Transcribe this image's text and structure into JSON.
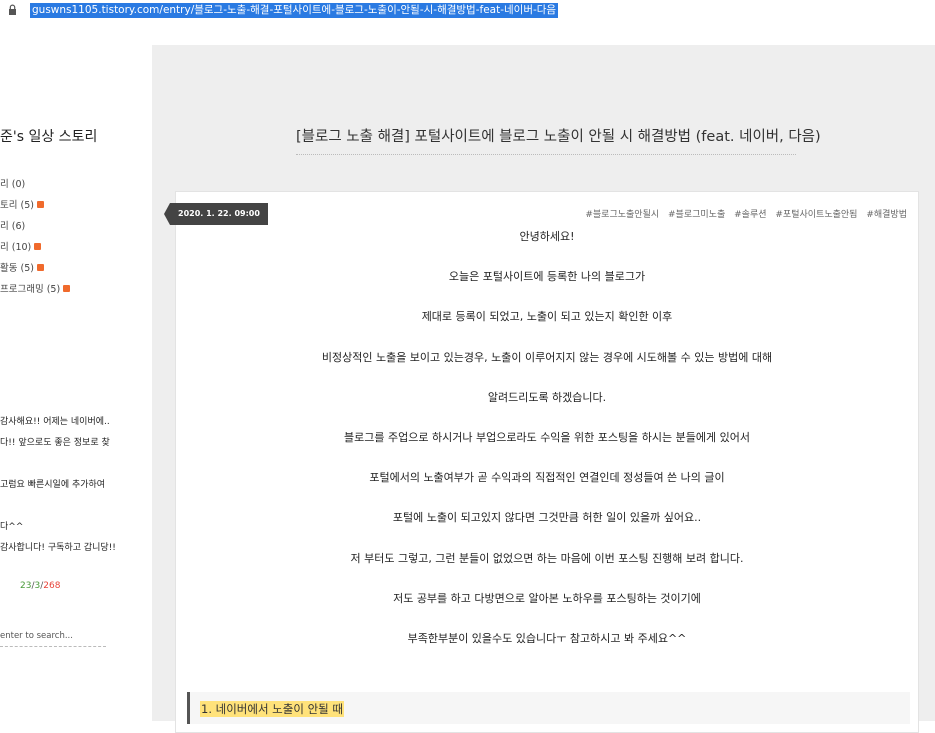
{
  "address_bar": {
    "url": "guswns1105.tistory.com/entry/블로그-노출-해결-포털사이트에-블로그-노출이-안될-시-해결방법-feat-네이버-다음",
    "url_highlight_color": "#2a7ae2"
  },
  "sidebar": {
    "blog_title": "준's 일상 스토리",
    "categories": [
      {
        "label": "리 (0)",
        "new": false
      },
      {
        "label": "토리 (5)",
        "new": true
      },
      {
        "label": "리 (6)",
        "new": false
      },
      {
        "label": "리 (10)",
        "new": true
      },
      {
        "label": "활동 (5)",
        "new": true
      },
      {
        "label": "프로그래밍 (5)",
        "new": true
      }
    ],
    "recent_comments": [
      "감사해요!! 어제는 네이버에..",
      "다!! 앞으로도 좋은 정보로 찾",
      "",
      "고럼요 빠른시일에 추가하여",
      "",
      "다^^",
      "감사합니다! 구독하고 갑니당!!"
    ],
    "counter": {
      "today": "23",
      "yesterday": "3",
      "total": "268",
      "separator": "/"
    },
    "search": {
      "placeholder": "enter to search..."
    }
  },
  "post": {
    "title": "[블로그 노출 해결] 포털사이트에 블로그 노출이 안될 시 해결방법 (feat. 네이버, 다음)",
    "date": "2020. 1. 22. 09:00",
    "tags": [
      "#블로그노출안될시",
      "#블로그미노출",
      "#솔루션",
      "#포털사이트노출안됨",
      "#해결방법"
    ],
    "paragraphs": [
      "안녕하세요!",
      "오늘은 포털사이트에 등록한 나의 블로그가",
      "제대로 등록이 되었고, 노출이 되고 있는지 확인한 이후",
      "비정상적인 노출을 보이고 있는경우, 노출이 이루어지지 않는 경우에 시도해볼 수 있는 방법에 대해",
      "알려드리도록 하겠습니다.",
      "블로그를 주업으로 하시거나 부업으로라도 수익을 위한 포스팅을 하시는 분들에게 있어서",
      "포털에서의 노출여부가 곧 수익과의 직접적인 연결인데 정성들여 쓴 나의 글이",
      "포털에 노출이 되고있지 않다면 그것만큼 허한 일이 있을까 싶어요..",
      "저 부터도 그렇고, 그런 분들이 없었으면 하는 마음에 이번 포스팅 진행해 보려 합니다.",
      "저도 공부를 하고 다방면으로 알아본 노하우를 포스팅하는 것이기에",
      "부족한부분이 있을수도 있습니다ㅜ 참고하시고 봐 주세요^^"
    ],
    "section_heading": "1. 네이버에서 노출이 안될 때"
  }
}
